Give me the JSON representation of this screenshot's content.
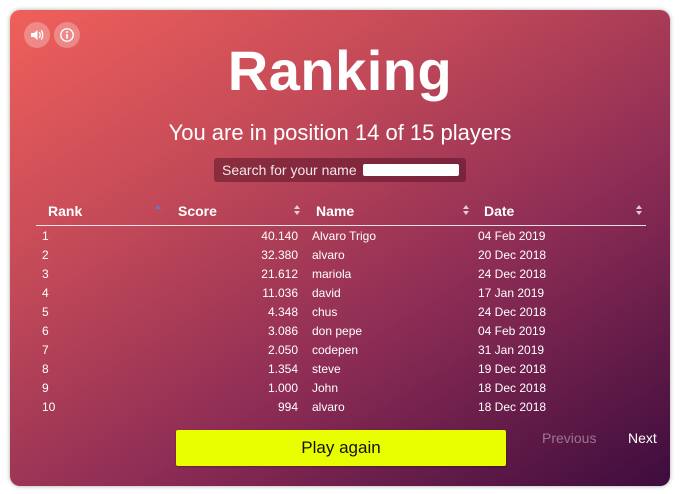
{
  "title": "Ranking",
  "subtitle": "You are in position 14 of 15 players",
  "search": {
    "label": "Search for your name",
    "value": "",
    "placeholder": ""
  },
  "table": {
    "columns": [
      "Rank",
      "Score",
      "Name",
      "Date"
    ],
    "rows": [
      [
        "1",
        "40.140",
        "Alvaro Trigo",
        "04 Feb 2019"
      ],
      [
        "2",
        "32.380",
        "alvaro",
        "20 Dec 2018"
      ],
      [
        "3",
        "21.612",
        "mariola",
        "24 Dec 2018"
      ],
      [
        "4",
        "11.036",
        "david",
        "17 Jan 2019"
      ],
      [
        "5",
        "4.348",
        "chus",
        "24 Dec 2018"
      ],
      [
        "6",
        "3.086",
        "don pepe",
        "04 Feb 2019"
      ],
      [
        "7",
        "2.050",
        "codepen",
        "31 Jan 2019"
      ],
      [
        "8",
        "1.354",
        "steve",
        "19 Dec 2018"
      ],
      [
        "9",
        "1.000",
        "John",
        "18 Dec 2018"
      ],
      [
        "10",
        "994",
        "alvaro",
        "18 Dec 2018"
      ]
    ]
  },
  "buttons": {
    "play_again": "Play again",
    "previous": "Previous",
    "next": "Next"
  },
  "icons": {
    "sound": "speaker-volume-icon",
    "info": "info-icon"
  },
  "colors": {
    "play_button": "#e9ff00",
    "gradient_start": "#f0605a",
    "gradient_end": "#3d0c3d",
    "sort_active": "#5b7bd8"
  }
}
